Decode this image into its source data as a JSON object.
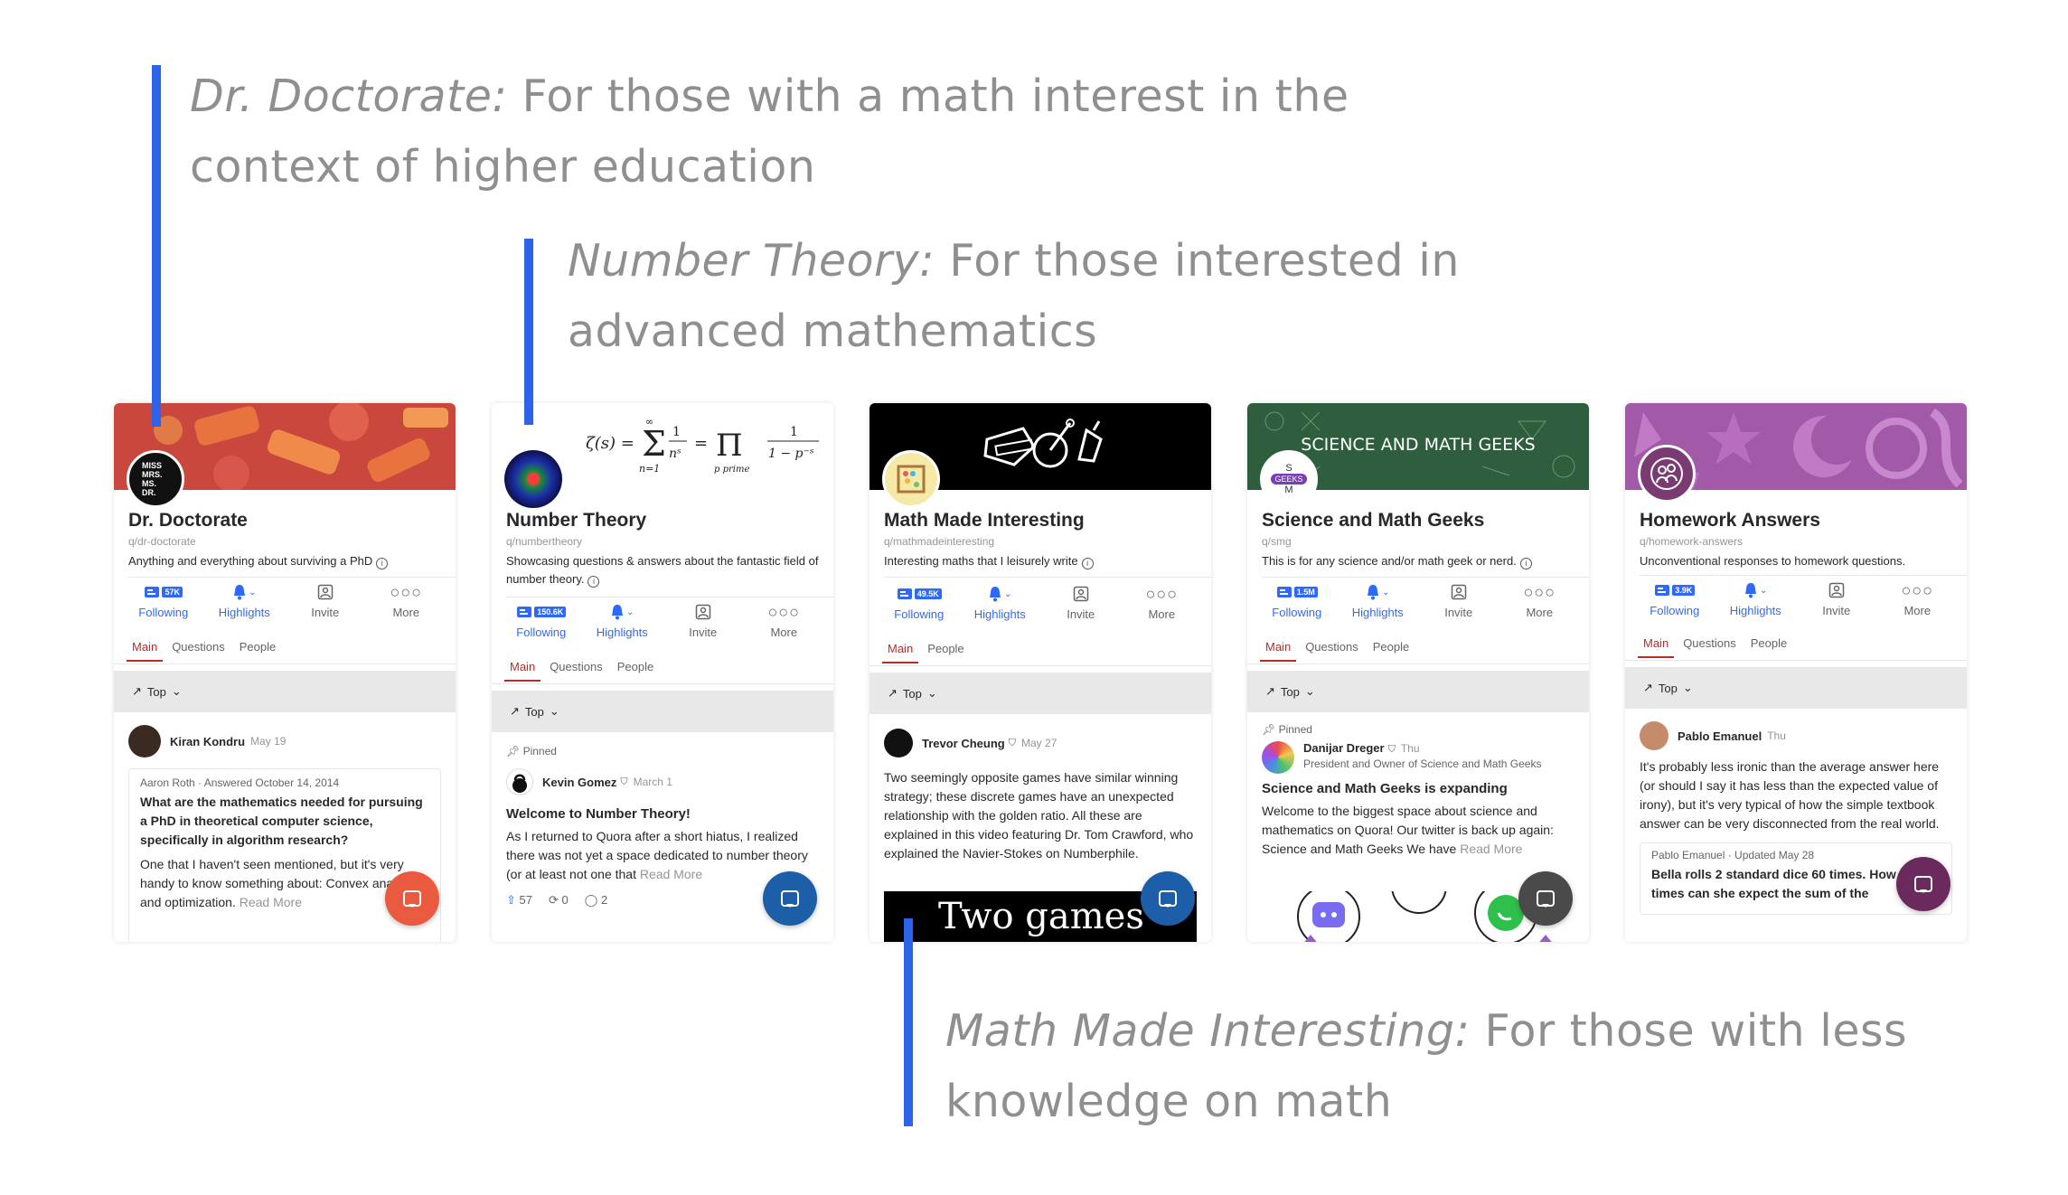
{
  "annotations": [
    {
      "name": "Dr. Doctorate:",
      "text": " For those with a math interest in the context of higher education"
    },
    {
      "name": "Number Theory:",
      "text": " For those interested in advanced mathematics"
    },
    {
      "name": "Math Made Interesting:",
      "text": " For those with less knowledge on math"
    }
  ],
  "colors": {
    "annotation_bar": "#2d63e8",
    "brand_blue": "#2e69ff",
    "active_tab": "#b92b27"
  },
  "cards": [
    {
      "title": "Dr. Doctorate",
      "slug": "q/dr-doctorate",
      "description": "Anything and everything about surviving a PhD",
      "icon_lines": [
        "MISS",
        "MRS.",
        "MS.",
        "DR."
      ],
      "followers": "57K",
      "actions": [
        "Following",
        "Highlights",
        "Invite",
        "More"
      ],
      "tabs": [
        "Main",
        "Questions",
        "People"
      ],
      "sort": "Top",
      "post_author": "Kiran Kondru",
      "post_date": "May 19",
      "answer_meta": "Aaron Roth · Answered October 14, 2014",
      "answer_q": "What are the mathematics needed for pursuing a PhD in theoretical computer science, specifically in algorithm research?",
      "answer_body": "One that I haven't seen mentioned, but it's very handy to know something about: Convex analysis and optimization.",
      "read_more": "Read More",
      "fab_color": "#ea5a3f"
    },
    {
      "title": "Number Theory",
      "slug": "q/numbertheory",
      "description": "Showcasing questions & answers about the fantastic field of number theory.",
      "followers": "150.6K",
      "actions": [
        "Following",
        "Highlights",
        "Invite",
        "More"
      ],
      "tabs": [
        "Main",
        "Questions",
        "People"
      ],
      "sort": "Top",
      "pinned": "Pinned",
      "post_author": "Kevin Gomez",
      "post_date": "March 1",
      "post_title": "Welcome to Number Theory!",
      "post_body": "As I returned to Quora after a short hiatus, I realized there was not yet a space dedicated to number theory (or at least not one that",
      "read_more": "Read More",
      "upvotes": "57",
      "shares": "0",
      "comments": "2",
      "fab_color": "#1c5fa8"
    },
    {
      "title": "Math Made Interesting",
      "slug": "q/mathmadeinteresting",
      "description": "Interesting maths that I leisurely write",
      "followers": "49.5K",
      "actions": [
        "Following",
        "Highlights",
        "Invite",
        "More"
      ],
      "tabs": [
        "Main",
        "People"
      ],
      "sort": "Top",
      "post_author": "Trevor Cheung",
      "post_date": "May 27",
      "post_body": "Two seemingly opposite games have similar winning strategy; these discrete games have an unexpected relationship with the golden ratio. All these are explained in this video featuring Dr. Tom Crawford, who explained the Navier-Stokes on Numberphile.",
      "video_text": "Two games",
      "fab_color": "#1c5fa8"
    },
    {
      "title": "Science and Math Geeks",
      "slug": "q/smg",
      "description": "This is for any science and/or math geek or nerd.",
      "cover_text": "SCIENCE AND MATH GEEKS",
      "icon_letters": [
        "S",
        "GEEKS",
        "M"
      ],
      "followers": "1.5M",
      "actions": [
        "Following",
        "Highlights",
        "Invite",
        "More"
      ],
      "tabs": [
        "Main",
        "Questions",
        "People"
      ],
      "sort": "Top",
      "pinned": "Pinned",
      "post_author": "Danijar Dreger",
      "post_date": "Thu",
      "post_credential": "President and Owner of Science and Math Geeks",
      "post_title": "Science and Math Geeks is expanding",
      "post_body": "Welcome to the biggest space about science and mathematics on Quora! Our twitter is back up again: Science and Math Geeks We have",
      "read_more": "Read More",
      "fab_color": "#4a4a4a"
    },
    {
      "title": "Homework Answers",
      "slug": "q/homework-answers",
      "description": "Unconventional responses to homework questions.",
      "followers": "3.9K",
      "actions": [
        "Following",
        "Highlights",
        "Invite",
        "More"
      ],
      "tabs": [
        "Main",
        "Questions",
        "People"
      ],
      "sort": "Top",
      "post_author": "Pablo Emanuel",
      "post_date": "Thu",
      "post_body": "It's probably less ironic than the average answer here (or should I say it has less than the expected value of irony), but it's very typical of how the simple textbook answer can be very disconnected from the real world.",
      "answer_meta": "Pablo Emanuel · Updated May 28",
      "answer_q": "Bella rolls 2 standard dice 60 times. How many times can she expect the sum of the",
      "fab_color": "#6b2a5e"
    }
  ]
}
